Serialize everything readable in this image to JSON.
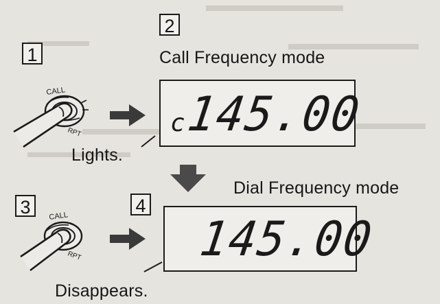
{
  "steps": [
    {
      "number": "1"
    },
    {
      "number": "2"
    },
    {
      "number": "3"
    },
    {
      "number": "4"
    }
  ],
  "captions": {
    "call_mode": "Call Frequency mode",
    "dial_mode": "Dial Frequency mode",
    "lights": "Lights.",
    "disappears": "Disappears."
  },
  "displays": {
    "call": {
      "prefix": "c",
      "frequency": "145.00"
    },
    "dial": {
      "frequency": "145.00"
    }
  },
  "button": {
    "top_label": "CALL",
    "bottom_label": "RPT"
  }
}
